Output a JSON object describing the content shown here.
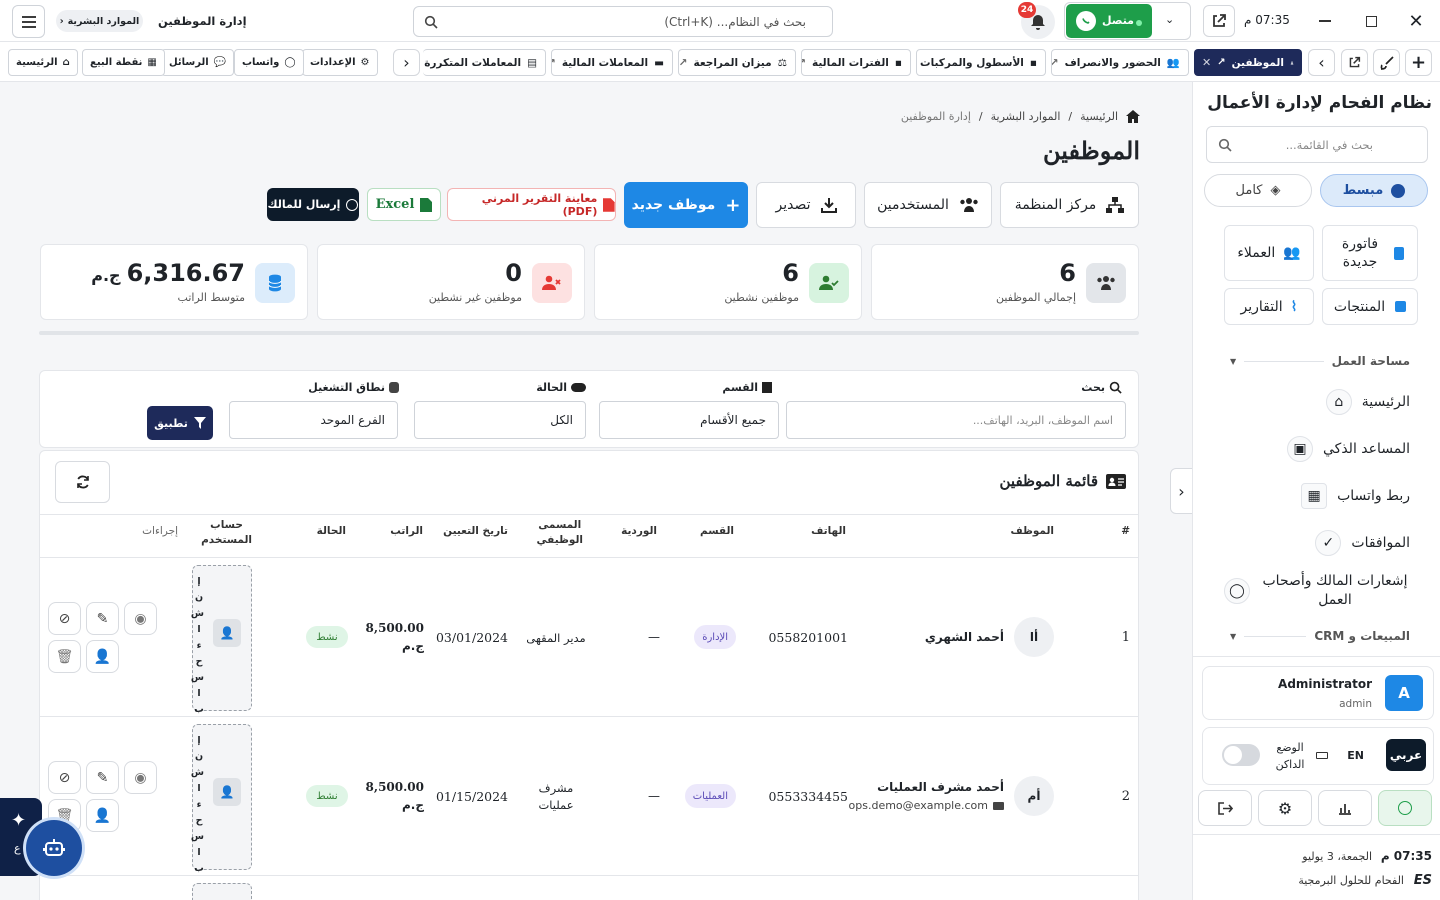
{
  "topbar": {
    "time": "07:35 م",
    "whatsapp_status": "متصل",
    "notifications_count": "24",
    "search_placeholder": "بحث في النظام... (Ctrl+K)",
    "page_title": "إدارة الموظفين",
    "section_chip": "الموارد البشرية"
  },
  "tabs": {
    "active": "الموظفين",
    "items": [
      "الحضور والانصراف",
      "الأسطول والمركبات",
      "الفترات المالية",
      "ميزان المراجعة",
      "المعاملات المالية",
      "المعاملات المتكررة"
    ],
    "quick": [
      "الإعدادات",
      "واتساب",
      "الرسائل",
      "نقطة البيع",
      "الرئيسية"
    ]
  },
  "breadcrumb": [
    "الرئيسية",
    "الموارد البشرية",
    "إدارة الموظفين"
  ],
  "page": {
    "title": "الموظفين",
    "actions": {
      "org_center": "مركز المنظمة",
      "users": "المستخدمين",
      "export": "تصدير",
      "new_employee": "موظف جديد",
      "pdf": "معاينة التقرير المرني (PDF)",
      "excel": "Excel",
      "send_owner": "إرسال للمالك"
    }
  },
  "stats": [
    {
      "value": "6",
      "label": "إجمالي الموظفين"
    },
    {
      "value": "6",
      "label": "موظفين نشطين"
    },
    {
      "value": "0",
      "label": "موظفين غير نشطين"
    },
    {
      "value": "6,316.67",
      "unit": "ج.م",
      "label": "متوسط الراتب"
    }
  ],
  "filters": {
    "search_label": "بحث",
    "search_placeholder": "اسم الموظف، البريد، الهاتف...",
    "dept_label": "القسم",
    "dept_value": "جميع الأقسام",
    "status_label": "الحالة",
    "status_value": "الكل",
    "scope_label": "نطاق التشغيل",
    "scope_value": "الفرع الموحد",
    "apply": "تطبيق"
  },
  "table": {
    "title": "قائمة الموظفين",
    "headers": {
      "num": "#",
      "employee": "الموظف",
      "phone": "الهاتف",
      "dept": "القسم",
      "shift": "الوردية",
      "job1": "المسمى",
      "job2": "الوظيفي",
      "hire": "تاريخ التعيين",
      "salary": "الراتب",
      "status": "الحالة",
      "account1": "حساب",
      "account2": "المستخدم",
      "actions": "إجراءات"
    },
    "rows": [
      {
        "num": "1",
        "initials": "أا",
        "name": "أحمد الشهري",
        "email": "",
        "phone": "0558201001",
        "dept": "الإدارة",
        "shift": "—",
        "job": "مدير المقهى",
        "hire": "03/01/2024",
        "salary": "8,500.00",
        "currency": "ج.م",
        "status": "نشط"
      },
      {
        "num": "2",
        "initials": "أم",
        "name": "أحمد مشرف العمليات",
        "email": "ops.demo@example.com",
        "phone": "0553334455",
        "dept": "العمليات",
        "shift": "—",
        "job": "مشرف عمليات",
        "hire": "01/15/2024",
        "salary": "8,500.00",
        "currency": "ج.م",
        "status": "نشط"
      }
    ],
    "vertical_create": [
      "إ",
      "ن",
      "ش",
      "ا",
      "ء",
      "ح",
      "س",
      "ا",
      "ب"
    ]
  },
  "sidebar": {
    "brand": "نظام الفحام لإدارة الأعمال",
    "search_placeholder": "بحث في القائمة...",
    "mode_simple": "مبسط",
    "mode_full": "كامل",
    "quick": [
      "فاتورة جديدة",
      "العملاء",
      "المنتجات",
      "التقارير"
    ],
    "workspace_header": "مساحة العمل",
    "workspace": [
      "الرئيسية",
      "المساعد الذكي",
      "ربط واتساب",
      "الموافقات",
      "إشعارات المالك وأصحاب العمل"
    ],
    "sales_header": "المبيعات و CRM",
    "user_name": "Administrator",
    "user_role": "admin",
    "user_initial": "A",
    "lang_ar": "عربي",
    "lang_en": "EN",
    "dark_mode": "الوضع الداكن",
    "clock": "07:35 م",
    "date": "الجمعة، 3 يوليو",
    "company": "الفحام للحلول البرمجية"
  },
  "assistant_label": "ع",
  "colors": {
    "primary": "#1e88e5",
    "whatsapp": "#1e9e4a",
    "navy": "#1e2a5a",
    "danger": "#e53935"
  }
}
